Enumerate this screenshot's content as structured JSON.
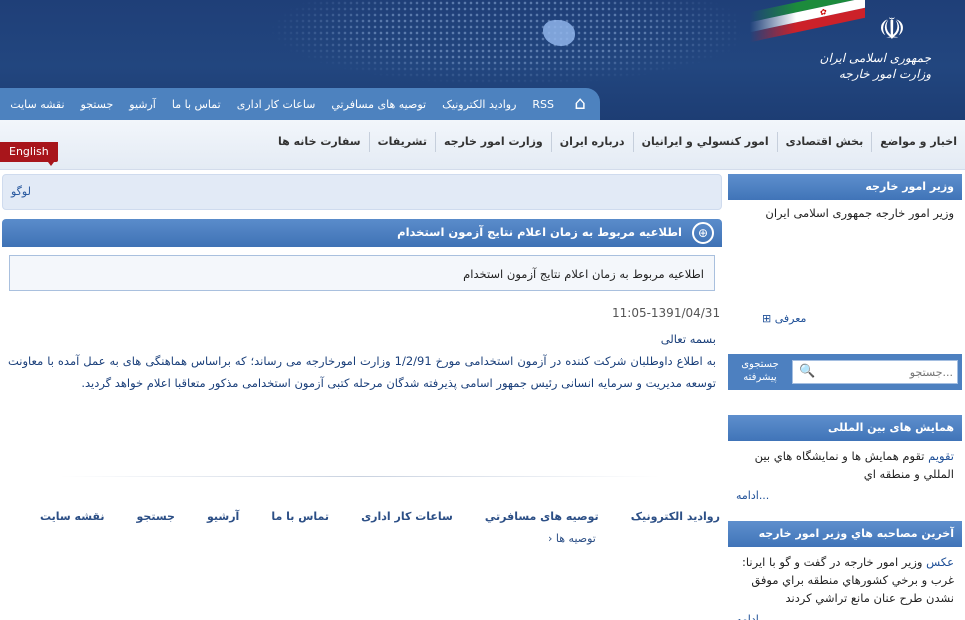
{
  "header": {
    "logo_line1": "جمهوری اسلامی ایران",
    "logo_line2": "وزارت امور خارجه",
    "emblem": "emblem-icon"
  },
  "topnav": {
    "home_icon": "home-icon",
    "items": [
      "RSS",
      "روادید الکترونیک",
      "توصیه های مسافرتي",
      "ساعات کار اداری",
      "تماس با ما",
      "آرشیو",
      "جستجو",
      "نقشه سایت"
    ]
  },
  "mainnav": {
    "items": [
      "اخبار و مواضع",
      "بخش اقتصادی",
      "امور کنسولي و ايرانيان",
      "درباره ایران",
      "وزارت امور خارجه",
      "تشریفات",
      "سفارت خانه ها"
    ]
  },
  "language_button": "English",
  "logo_placeholder": "لوگو",
  "article": {
    "title": "اطلاعیه مربوط به زمان اعلام نتایج آزمون استخدام",
    "summary": "اطلاعیه مربوط به زمان اعلام نتایج آزمون استخدام",
    "date": "11:05-1391/04/31",
    "greeting": "بسمه تعالی",
    "body": "به اطلاع داوطلبان شرکت کننده در آزمون استخدامی مورخ 1/2/91 وزارت امورخارجه می رساند؛ که براساس هماهنگی های به عمل آمده با معاونت توسعه مدیریت و سرمایه انسانی رئیس جمهور اسامی پذیرفته شدگان مرحله کتبی آزمون استخدامی مذکور متعاقبا اعلام خواهد گردید."
  },
  "footnav": {
    "items": [
      "روادید الکترونیک",
      "توصیه های مسافرتي",
      "ساعات کار اداری",
      "تماس با ما",
      "آرشیو",
      "جستجو",
      "نقشه سایت"
    ],
    "breadcrumb": "› توصیه ها"
  },
  "sidebar": {
    "minister": {
      "title": "وزیر امور خارجه",
      "text": "وزیر امور خارجه جمهوری اسلامی ایران",
      "more": "معرفی"
    },
    "search": {
      "advanced": "جستجوی پیشرفته",
      "placeholder": "جستجو..."
    },
    "conferences": {
      "title": "همایش های بین المللی",
      "link": "تقویم",
      "text": "تقوم همايش ها و نمايشگاه هاي بين المللي و منطقه اي",
      "more": "ادامه..."
    },
    "interviews": {
      "title": "آخرین مصاحبه هاي وزير امور خارجه",
      "link": "عكس",
      "text": "وزير امور خارجه در گفت و گو با ايرنا: غرب و برخي کشورهاي منطقه براي موفق نشدن طرح عنان مانع تراشي کردند",
      "more": "ادامه..."
    }
  },
  "colors": {
    "header_bg": "#22467f",
    "nav_blue": "#4d82bf",
    "english_red": "#a8151b",
    "link_blue": "#1e4f97"
  }
}
